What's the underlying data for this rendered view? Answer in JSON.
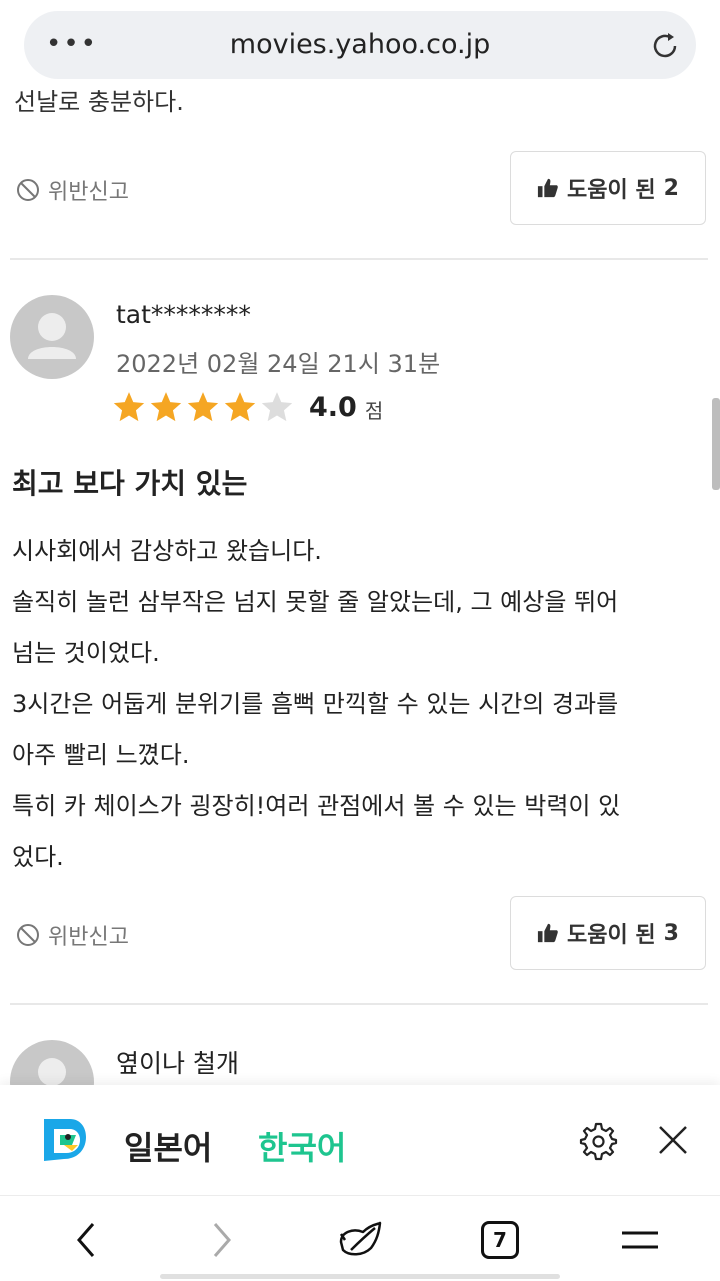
{
  "browser": {
    "url": "movies.yahoo.co.jp",
    "menu_icon": "more-dots-icon",
    "reload_icon": "reload-icon"
  },
  "prev_review": {
    "partial_text": "선날로 충분하다.",
    "report_label": "위반신고",
    "helpful_label": "도움이 된",
    "helpful_count": "2"
  },
  "review": {
    "username": "tat********",
    "datetime": "2022년 02월 24일 21시 31분",
    "rating": 4.0,
    "rating_max": 5,
    "score_text": "4.0",
    "score_unit": "점",
    "title": "최고 보다 가치 있는",
    "body_lines": [
      "시사회에서 감상하고 왔습니다.",
      "솔직히 놀런 삼부작은 넘지 못할 줄 알았는데, 그 예상을 뛰어",
      "넘는 것이었다.",
      "3시간은 어둡게 분위기를 흠뻑 만끽할 수 있는 시간의 경과를",
      "아주 빨리 느꼈다.",
      "특히 카 체이스가 굉장히!여러 관점에서 볼 수 있는 박력이 있",
      "었다."
    ],
    "report_label": "위반신고",
    "helpful_label": "도움이 된",
    "helpful_count": "3"
  },
  "next_review": {
    "username": "옆이나 철개"
  },
  "translation_bar": {
    "source_language": "일본어",
    "target_language": "한국어",
    "accent_color": "#1ec58f"
  },
  "bottom_nav": {
    "tab_count": "7"
  },
  "colors": {
    "star_filled": "#f5a623",
    "star_empty": "#dddddd"
  }
}
